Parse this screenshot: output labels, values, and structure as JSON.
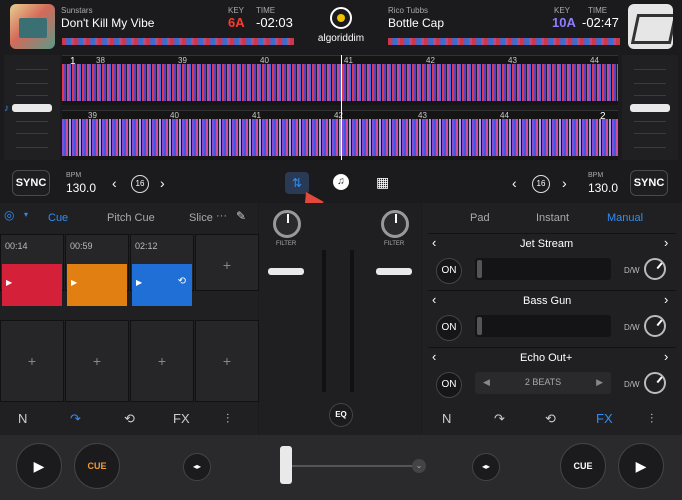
{
  "deck_left": {
    "artist": "Sunstars",
    "title": "Don't Kill My Vibe",
    "key_label": "KEY",
    "key": "6A",
    "time_label": "TIME",
    "time": "-02:03",
    "key_color": "#ff3b30"
  },
  "deck_right": {
    "artist": "Rico Tubbs",
    "title": "Bottle Cap",
    "key_label": "KEY",
    "key": "10A",
    "time_label": "TIME",
    "time": "-02:47",
    "key_color": "#8e7dff"
  },
  "logo": "algoriddim",
  "wave_top_beats": [
    "1",
    "38",
    "39",
    "40",
    "41",
    "42",
    "43",
    "44"
  ],
  "wave_top_deck": "1",
  "wave_bottom_beats": [
    "39",
    "40",
    "41",
    "42",
    "43",
    "44"
  ],
  "wave_bottom_deck": "2",
  "controls": {
    "sync": "SYNC",
    "bpm_label": "BPM",
    "bpm_left": "130.0",
    "bpm_right": "130.0",
    "loop": "16"
  },
  "left_panel": {
    "tabs": [
      "Cue",
      "Pitch Cue",
      "Slice"
    ],
    "more": "···",
    "pads": [
      {
        "time": "00:14",
        "color": "#d5203a"
      },
      {
        "time": "00:59",
        "color": "#e17f12"
      },
      {
        "time": "02:12",
        "color": "#1f6fd6"
      }
    ],
    "plus": "+"
  },
  "mixer": {
    "filter": "FILTER",
    "eq": "EQ"
  },
  "right_panel": {
    "tabs": [
      "Pad",
      "Instant",
      "Manual"
    ],
    "active_tab": "Manual",
    "on": "ON",
    "dw": "D/W",
    "effects": [
      {
        "name": "Jet Stream",
        "value": ""
      },
      {
        "name": "Bass Gun",
        "value": ""
      },
      {
        "name": "Echo Out+",
        "value": "2 BEATS"
      }
    ]
  },
  "bottom": {
    "cue": "CUE",
    "fx": "FX"
  },
  "accent": "#2f8df5"
}
